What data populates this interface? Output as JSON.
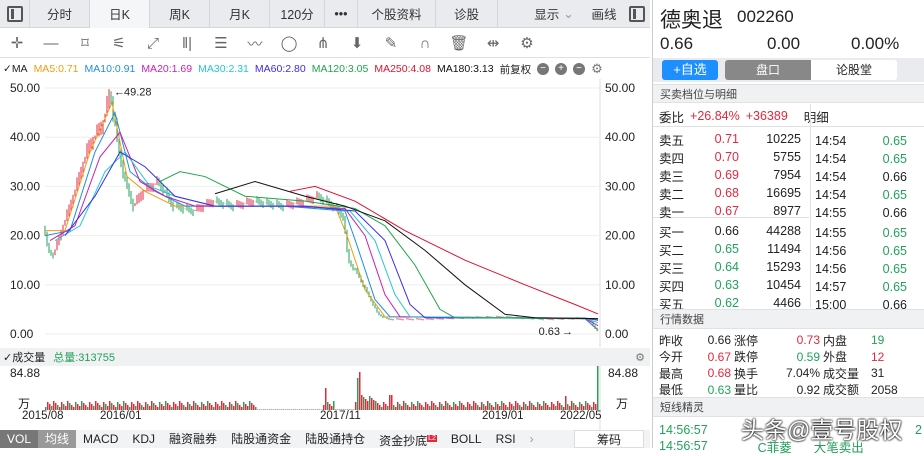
{
  "topbar": {
    "tabs": [
      "分时",
      "日K",
      "周K",
      "月K",
      "120分",
      "•••",
      "个股资料",
      "诊股"
    ],
    "display": "显示",
    "draw": "画线"
  },
  "toolbar": {
    "tools": [
      "crosshair-icon",
      "line-icon",
      "rect-icon",
      "fan-icon",
      "channel-icon",
      "vertical-lines-icon",
      "text-icon",
      "wave-icon",
      "circle-icon",
      "pitchfork-icon",
      "arrow-down-icon",
      "eraser-icon",
      "magnet-icon",
      "trash-icon",
      "split-icon",
      "settings-icon"
    ]
  },
  "ma_legend": {
    "label": "MA",
    "items": [
      {
        "text": "MA5:0.71",
        "color": "#f39c12"
      },
      {
        "text": "MA10:0.91",
        "color": "#1e8fe1"
      },
      {
        "text": "MA20:1.69",
        "color": "#c81fb4"
      },
      {
        "text": "MA30:2.31",
        "color": "#25c6d8"
      },
      {
        "text": "MA60:2.80",
        "color": "#3a2ee8"
      },
      {
        "text": "MA120:3.05",
        "color": "#1fa64a"
      },
      {
        "text": "MA250:4.08",
        "color": "#e0112f"
      },
      {
        "text": "MA180:3.13",
        "color": "#111111"
      }
    ],
    "adjust": "前复权"
  },
  "price_chart": {
    "y_ticks": [
      "50.00",
      "40.00",
      "30.00",
      "20.00",
      "10.00",
      "0.00"
    ],
    "high_label": "49.28",
    "low_label": "0.63"
  },
  "chart_data": {
    "type": "line",
    "ylim": [
      0,
      50
    ],
    "price": [
      [
        0,
        22
      ],
      [
        5,
        17
      ],
      [
        10,
        16
      ],
      [
        20,
        22
      ],
      [
        30,
        28
      ],
      [
        45,
        38
      ],
      [
        60,
        43
      ],
      [
        67,
        49.28
      ],
      [
        75,
        38
      ],
      [
        82,
        31
      ],
      [
        90,
        26
      ],
      [
        100,
        29
      ],
      [
        115,
        31
      ],
      [
        130,
        26
      ],
      [
        150,
        25
      ],
      [
        170,
        27
      ],
      [
        190,
        26
      ],
      [
        210,
        27
      ],
      [
        240,
        26
      ],
      [
        260,
        27
      ],
      [
        275,
        28
      ],
      [
        290,
        26
      ],
      [
        300,
        24
      ],
      [
        305,
        15
      ],
      [
        315,
        12
      ],
      [
        325,
        8
      ],
      [
        335,
        4
      ],
      [
        345,
        3
      ],
      [
        380,
        3
      ],
      [
        420,
        3.3
      ],
      [
        460,
        3.5
      ],
      [
        500,
        3
      ],
      [
        540,
        3.2
      ],
      [
        548,
        2.5
      ],
      [
        553,
        0.63
      ]
    ],
    "ma": [
      {
        "name": "MA5",
        "color": "#f39c12",
        "points": [
          [
            0,
            21
          ],
          [
            20,
            21
          ],
          [
            45,
            37
          ],
          [
            67,
            47
          ],
          [
            82,
            32
          ],
          [
            100,
            29
          ],
          [
            130,
            26
          ],
          [
            240,
            26
          ],
          [
            290,
            26
          ],
          [
            302,
            20
          ],
          [
            320,
            9
          ],
          [
            340,
            3.5
          ],
          [
            540,
            3.1
          ],
          [
            553,
            0.7
          ]
        ]
      },
      {
        "name": "MA10",
        "color": "#1e8fe1",
        "points": [
          [
            0,
            20
          ],
          [
            25,
            21
          ],
          [
            50,
            37
          ],
          [
            70,
            45
          ],
          [
            85,
            33
          ],
          [
            110,
            29
          ],
          [
            140,
            26
          ],
          [
            240,
            26
          ],
          [
            300,
            25
          ],
          [
            312,
            18
          ],
          [
            330,
            7
          ],
          [
            345,
            3.5
          ],
          [
            540,
            3.1
          ],
          [
            553,
            0.9
          ]
        ]
      },
      {
        "name": "MA20",
        "color": "#c81fb4",
        "points": [
          [
            5,
            19
          ],
          [
            30,
            22
          ],
          [
            55,
            36
          ],
          [
            75,
            41
          ],
          [
            95,
            31
          ],
          [
            120,
            28
          ],
          [
            150,
            26
          ],
          [
            240,
            26
          ],
          [
            300,
            25.5
          ],
          [
            320,
            20
          ],
          [
            340,
            8
          ],
          [
            355,
            3.5
          ],
          [
            540,
            3.2
          ],
          [
            553,
            1.7
          ]
        ]
      },
      {
        "name": "MA30",
        "color": "#25c6d8",
        "points": [
          [
            10,
            19
          ],
          [
            35,
            22
          ],
          [
            60,
            33
          ],
          [
            80,
            37
          ],
          [
            105,
            30
          ],
          [
            130,
            28
          ],
          [
            170,
            26
          ],
          [
            260,
            26
          ],
          [
            305,
            25
          ],
          [
            330,
            19
          ],
          [
            350,
            8
          ],
          [
            365,
            3.5
          ],
          [
            540,
            3.2
          ],
          [
            553,
            2.3
          ]
        ]
      },
      {
        "name": "MA60",
        "color": "#3a2ee8",
        "points": [
          [
            20,
            20
          ],
          [
            50,
            28
          ],
          [
            75,
            37
          ],
          [
            100,
            34
          ],
          [
            130,
            28
          ],
          [
            170,
            26
          ],
          [
            260,
            26
          ],
          [
            310,
            25
          ],
          [
            340,
            19
          ],
          [
            365,
            6
          ],
          [
            380,
            3.3
          ],
          [
            540,
            3.2
          ],
          [
            553,
            2.8
          ]
        ]
      },
      {
        "name": "MA120",
        "color": "#1fa64a",
        "points": [
          [
            115,
            31
          ],
          [
            135,
            33
          ],
          [
            160,
            32
          ],
          [
            200,
            28
          ],
          [
            260,
            27
          ],
          [
            310,
            25.5
          ],
          [
            340,
            22
          ],
          [
            370,
            14
          ],
          [
            395,
            5
          ],
          [
            410,
            3.3
          ],
          [
            540,
            3.2
          ],
          [
            553,
            3.05
          ]
        ]
      },
      {
        "name": "MA180",
        "color": "#111111",
        "points": [
          [
            170,
            28.5
          ],
          [
            210,
            31
          ],
          [
            260,
            28
          ],
          [
            300,
            26
          ],
          [
            340,
            23
          ],
          [
            380,
            17
          ],
          [
            420,
            10
          ],
          [
            460,
            4
          ],
          [
            490,
            3.3
          ],
          [
            553,
            3.13
          ]
        ]
      },
      {
        "name": "MA250",
        "color": "#e0112f",
        "points": [
          [
            245,
            29
          ],
          [
            270,
            30
          ],
          [
            310,
            27
          ],
          [
            360,
            21
          ],
          [
            420,
            15
          ],
          [
            480,
            10
          ],
          [
            530,
            6
          ],
          [
            553,
            4.08
          ]
        ]
      }
    ]
  },
  "volume": {
    "label": "成交量",
    "total": "总量:313755",
    "max": "84.88",
    "unit": "万",
    "dates": [
      "2015/08",
      "2016/01",
      "2017/11",
      "2019/01",
      "2022/05"
    ]
  },
  "bottom_tabs": [
    "VOL",
    "均线",
    "MACD",
    "KDJ",
    "融资融券",
    "陆股通资金",
    "陆股通持仓",
    "资金抄底",
    "BOLL",
    "RSI"
  ],
  "badge": "L2",
  "chips": "筹码",
  "stock": {
    "name": "德奥退",
    "code": "002260",
    "price": "0.66",
    "change": "0.00",
    "pct": "0.00%"
  },
  "buttons": {
    "add": "+自选",
    "pankou": "盘口",
    "lungutang": "论股堂"
  },
  "orderbook": {
    "title": "买卖档位与明细",
    "ratio_label": "委比",
    "ratio_pct": "+26.84%",
    "ratio_diff": "+36389",
    "detail_label": "明细",
    "sells": [
      [
        "卖五",
        "0.71",
        "10225"
      ],
      [
        "卖四",
        "0.70",
        "5755"
      ],
      [
        "卖三",
        "0.69",
        "7954"
      ],
      [
        "卖二",
        "0.68",
        "16695"
      ],
      [
        "卖一",
        "0.67",
        "8977"
      ]
    ],
    "buys": [
      [
        "买一",
        "0.66",
        "44288"
      ],
      [
        "买二",
        "0.65",
        "11494"
      ],
      [
        "买三",
        "0.64",
        "15293"
      ],
      [
        "买四",
        "0.63",
        "10454"
      ],
      [
        "买五",
        "0.62",
        "4466"
      ]
    ],
    "ticks": [
      [
        "14:54",
        "0.65",
        "g"
      ],
      [
        "14:54",
        "0.65",
        "g"
      ],
      [
        "14:54",
        "0.66",
        "n"
      ],
      [
        "14:54",
        "0.65",
        "g"
      ],
      [
        "14:55",
        "0.66",
        "n"
      ],
      [
        "14:55",
        "0.65",
        "g"
      ],
      [
        "14:56",
        "0.65",
        "g"
      ],
      [
        "14:56",
        "0.65",
        "g"
      ],
      [
        "14:57",
        "0.65",
        "g"
      ],
      [
        "15:00",
        "0.66",
        "n"
      ]
    ]
  },
  "quote": {
    "title": "行情数据",
    "rows": [
      [
        "昨收",
        "0.66",
        "涨停",
        "0.73",
        "内盘",
        "19"
      ],
      [
        "今开",
        "0.67",
        "跌停",
        "0.59",
        "外盘",
        "12"
      ],
      [
        "最高",
        "0.68",
        "换手",
        "7.04%",
        "成交量",
        "31"
      ],
      [
        "最低",
        "0.63",
        "量比",
        "0.92",
        "成交额",
        "2058"
      ]
    ]
  },
  "sprite": {
    "title": "短线精灵",
    "rows": [
      [
        "14:56:57",
        "",
        "",
        "2"
      ],
      [
        "14:56:57",
        "C菲菱",
        "大笔卖出",
        ""
      ]
    ]
  },
  "watermark": "头条@壹号股权"
}
